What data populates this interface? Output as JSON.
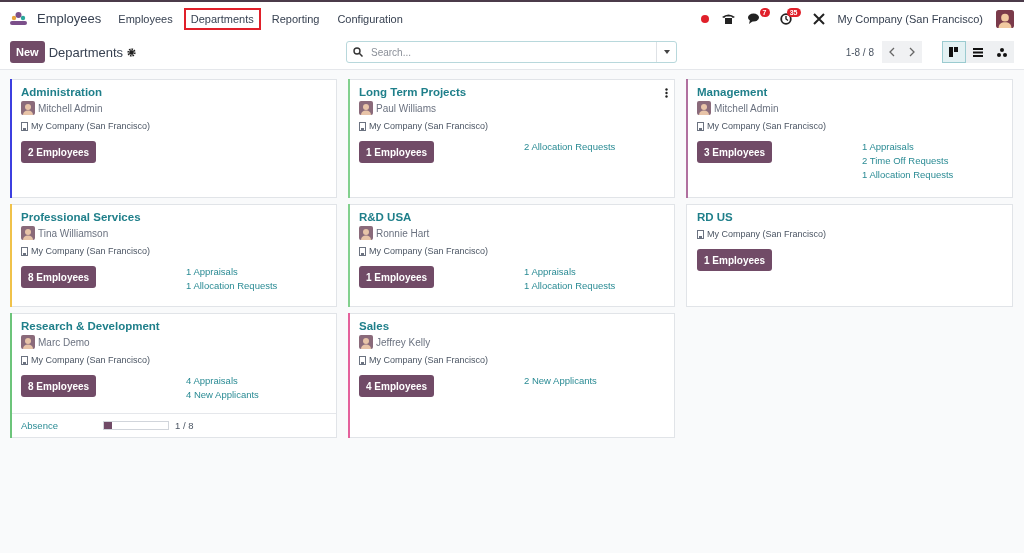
{
  "app": {
    "name": "Employees"
  },
  "menu": [
    {
      "label": "Employees",
      "highlighted": false
    },
    {
      "label": "Departments",
      "highlighted": true
    },
    {
      "label": "Reporting",
      "highlighted": false
    },
    {
      "label": "Configuration",
      "highlighted": false
    }
  ],
  "systray": {
    "chat_count": "7",
    "activity_count": "35",
    "company": "My Company (San Francisco)"
  },
  "control_panel": {
    "new_button": "New",
    "title": "Departments",
    "search": {
      "placeholder": "Search..."
    },
    "pager": "1-8 / 8",
    "views": [
      {
        "kind": "kanban",
        "selected": true
      },
      {
        "kind": "list",
        "selected": false
      },
      {
        "kind": "hierarchy",
        "selected": false
      }
    ]
  },
  "columns": [
    [
      {
        "name": "Administration",
        "color": "#3c3fe0",
        "manager": "Mitchell Admin",
        "company": "My Company (San Francisco)",
        "employees": "2 Employees",
        "menu": false
      },
      {
        "name": "Professional Services",
        "color": "#f0c24a",
        "manager": "Tina Williamson",
        "company": "My Company (San Francisco)",
        "employees": "8 Employees",
        "links": [
          "1 Appraisals",
          "1 Allocation Requests"
        ],
        "menu": false
      },
      {
        "name": "Research & Development",
        "color": "#6cc47a",
        "manager": "Marc Demo",
        "company": "My Company (San Francisco)",
        "employees": "8 Employees",
        "links": [
          "4 Appraisals",
          "4 New Applicants"
        ],
        "menu": false,
        "absence": {
          "label": "Absence",
          "level": 0.125,
          "reading": "1 / 8"
        }
      }
    ],
    [
      {
        "name": "Long Term Projects",
        "color": "#82d08e",
        "manager": "Paul Williams",
        "company": "My Company (San Francisco)",
        "employees": "1 Employees",
        "links": [
          "2 Allocation Requests"
        ],
        "menu": true
      },
      {
        "name": "R&D USA",
        "color": "#82d08e",
        "manager": "Ronnie Hart",
        "company": "My Company (San Francisco)",
        "employees": "1 Employees",
        "links": [
          "1 Appraisals",
          "1 Allocation Requests"
        ],
        "menu": false
      },
      {
        "name": "Sales",
        "color": "#e4619c",
        "manager": "Jeffrey Kelly",
        "company": "My Company (San Francisco)",
        "employees": "4 Employees",
        "links": [
          "2 New Applicants"
        ],
        "menu": false
      }
    ],
    [
      {
        "name": "Management",
        "color": "#b0709f",
        "manager": "Mitchell Admin",
        "company": "My Company (San Francisco)",
        "employees": "3 Employees",
        "links": [
          "1 Appraisals",
          "2 Time Off Requests",
          "1 Allocation Requests"
        ],
        "menu": false
      },
      {
        "name": "RD US",
        "company": "My Company (San Francisco)",
        "employees": "1 Employees",
        "menu": false
      }
    ]
  ]
}
